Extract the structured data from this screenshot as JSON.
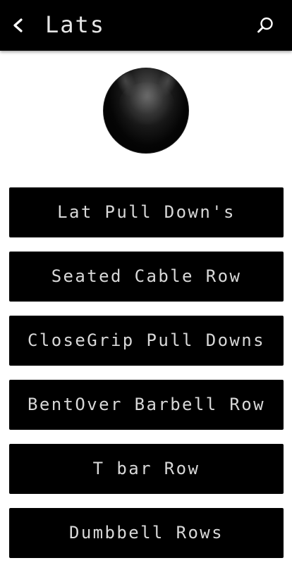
{
  "toolbar": {
    "title": "Lats",
    "back_icon": "chevron-left-icon",
    "search_icon": "search-icon",
    "background": "#000000",
    "title_color": "#e6e6e6"
  },
  "header_image": {
    "icon": "avatar"
  },
  "exercises": [
    {
      "label": "Lat Pull Down's"
    },
    {
      "label": "Seated Cable Row"
    },
    {
      "label": "CloseGrip Pull Downs"
    },
    {
      "label": "BentOver Barbell Row"
    },
    {
      "label": "T bar Row"
    },
    {
      "label": "Dumbbell Rows"
    }
  ],
  "colors": {
    "button_background": "#000000",
    "button_text": "#d8d8d8",
    "page_background": "#ffffff"
  }
}
